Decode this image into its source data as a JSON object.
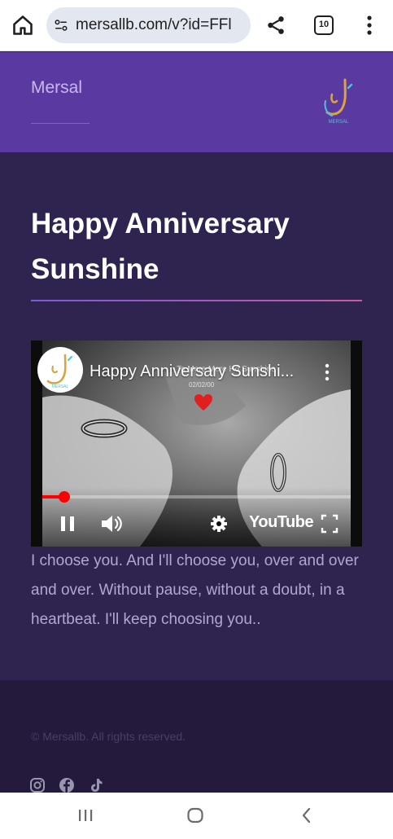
{
  "browser": {
    "url": "mersallb.com/v?id=FFl",
    "tab_count": "10"
  },
  "header": {
    "site_name": "Mersal",
    "logo_text": "MERSAL"
  },
  "main": {
    "title": "Happy Anniversary Sunshine",
    "video": {
      "channel_logo_text": "MERSAL",
      "title": "Happy Anniversary Sunshi...",
      "overlay_text": "To Mere Mere Ho Sunshine",
      "overlay_date": "02/02/00",
      "brand": "YouTube",
      "progress": 0.07
    },
    "description": "I choose you. And I'll choose you, over and over and over. Without pause, without a doubt, in a heartbeat. I'll keep choosing you.."
  },
  "footer": {
    "copyright": "© Mersallb. All rights reserved.",
    "social_icons": [
      "instagram-icon",
      "facebook-icon",
      "tiktok-icon"
    ]
  },
  "colors": {
    "header_bg": "#5a3aa0",
    "page_bg": "#2f2450",
    "footer_bg": "#231a3c",
    "accent_red": "#ff0000"
  }
}
